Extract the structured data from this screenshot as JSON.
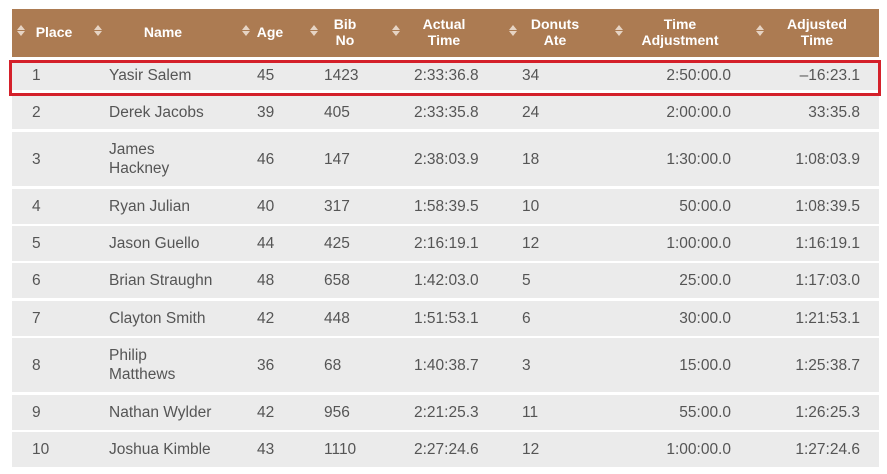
{
  "table": {
    "columns": [
      {
        "key": "place",
        "label": "Place"
      },
      {
        "key": "name",
        "label": "Name"
      },
      {
        "key": "age",
        "label": "Age"
      },
      {
        "key": "bib",
        "label": "Bib\nNo"
      },
      {
        "key": "actual",
        "label": "Actual\nTime"
      },
      {
        "key": "donuts",
        "label": "Donuts\nAte"
      },
      {
        "key": "adjust",
        "label": "Time\nAdjustment"
      },
      {
        "key": "adjusted",
        "label": "Adjusted\nTime"
      }
    ],
    "rows": [
      {
        "place": "1",
        "name": "Yasir Salem",
        "age": "45",
        "bib": "1423",
        "actual": "2:33:36.8",
        "donuts": "34",
        "adjust": "2:50:00.0",
        "adjusted": "–16:23.1"
      },
      {
        "place": "2",
        "name": "Derek Jacobs",
        "age": "39",
        "bib": "405",
        "actual": "2:33:35.8",
        "donuts": "24",
        "adjust": "2:00:00.0",
        "adjusted": "33:35.8"
      },
      {
        "place": "3",
        "name": "James\nHackney",
        "age": "46",
        "bib": "147",
        "actual": "2:38:03.9",
        "donuts": "18",
        "adjust": "1:30:00.0",
        "adjusted": "1:08:03.9"
      },
      {
        "place": "4",
        "name": "Ryan Julian",
        "age": "40",
        "bib": "317",
        "actual": "1:58:39.5",
        "donuts": "10",
        "adjust": "50:00.0",
        "adjusted": "1:08:39.5"
      },
      {
        "place": "5",
        "name": "Jason Guello",
        "age": "44",
        "bib": "425",
        "actual": "2:16:19.1",
        "donuts": "12",
        "adjust": "1:00:00.0",
        "adjusted": "1:16:19.1"
      },
      {
        "place": "6",
        "name": "Brian Straughn",
        "age": "48",
        "bib": "658",
        "actual": "1:42:03.0",
        "donuts": "5",
        "adjust": "25:00.0",
        "adjusted": "1:17:03.0"
      },
      {
        "place": "7",
        "name": "Clayton Smith",
        "age": "42",
        "bib": "448",
        "actual": "1:51:53.1",
        "donuts": "6",
        "adjust": "30:00.0",
        "adjusted": "1:21:53.1"
      },
      {
        "place": "8",
        "name": "Philip\nMatthews",
        "age": "36",
        "bib": "68",
        "actual": "1:40:38.7",
        "donuts": "3",
        "adjust": "15:00.0",
        "adjusted": "1:25:38.7"
      },
      {
        "place": "9",
        "name": "Nathan Wylder",
        "age": "42",
        "bib": "956",
        "actual": "2:21:25.3",
        "donuts": "11",
        "adjust": "55:00.0",
        "adjusted": "1:26:25.3"
      },
      {
        "place": "10",
        "name": "Joshua Kimble",
        "age": "43",
        "bib": "1110",
        "actual": "2:27:24.6",
        "donuts": "12",
        "adjust": "1:00:00.0",
        "adjusted": "1:27:24.6"
      }
    ],
    "highlighted_row": 1
  },
  "colors": {
    "header_bg": "#ac7b52",
    "row_bg": "#ebebeb",
    "highlight_border": "#d4202a",
    "text": "#555555"
  },
  "icons": {
    "sort": "sort-updown-icon"
  }
}
